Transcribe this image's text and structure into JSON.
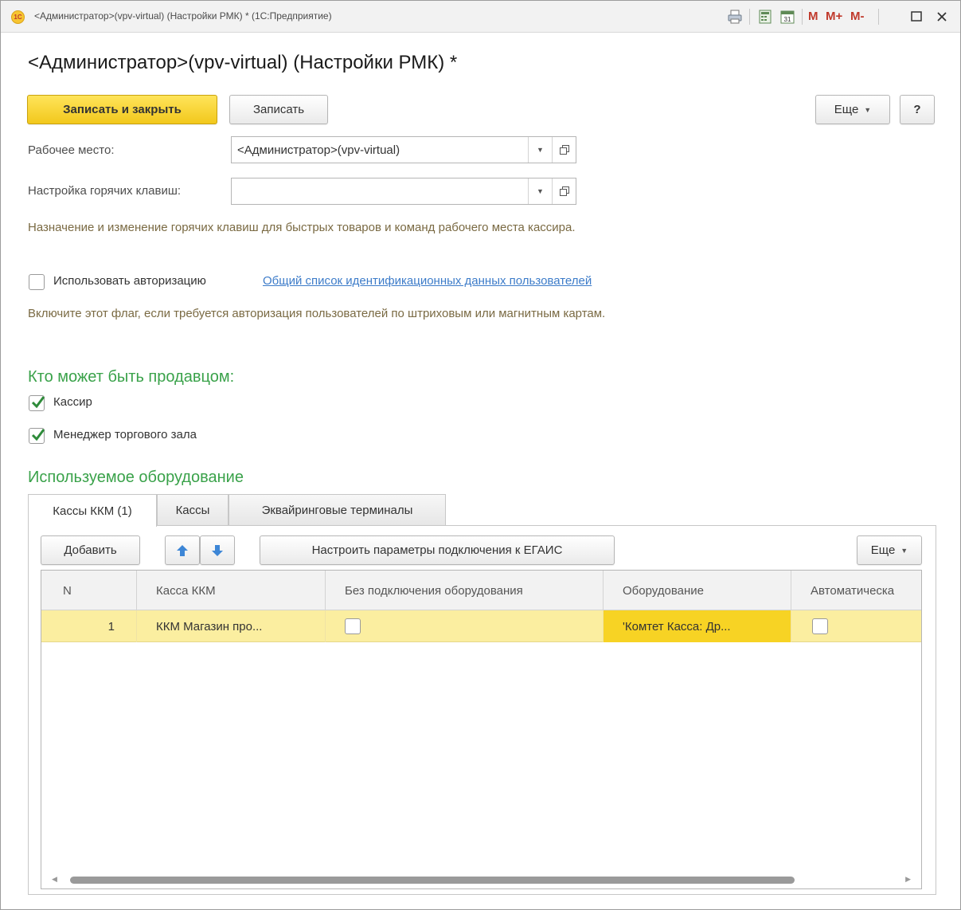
{
  "window": {
    "title": "<Администратор>(vpv-virtual) (Настройки РМК) * (1С:Предприятие)",
    "logo_text": "1С",
    "toolbar_m": "M",
    "toolbar_m_plus": "M+",
    "toolbar_m_minus": "M-"
  },
  "form": {
    "title": "<Администратор>(vpv-virtual) (Настройки РМК) *",
    "buttons": {
      "save_close": "Записать и закрыть",
      "save": "Записать",
      "more": "Еще",
      "help": "?"
    },
    "workplace_label": "Рабочее место:",
    "workplace_value": "<Администратор>(vpv-virtual)",
    "hotkeys_label": "Настройка горячих клавиш:",
    "hotkeys_value": "",
    "hotkeys_hint": "Назначение и изменение горячих клавиш для быстрых товаров и команд рабочего места кассира.",
    "use_auth_label": "Использовать авторизацию",
    "use_auth_checked": false,
    "auth_link": "Общий список идентификационных данных пользователей",
    "auth_hint": "Включите этот флаг, если требуется авторизация пользователей по штриховым или магнитным картам.",
    "sellers_title": "Кто может быть продавцом:",
    "sellers": [
      {
        "label": "Кассир",
        "checked": true
      },
      {
        "label": "Менеджер торгового зала",
        "checked": true
      }
    ],
    "equipment_title": "Используемое оборудование"
  },
  "tabs": [
    {
      "label": "Кассы ККМ (1)",
      "active": true
    },
    {
      "label": "Кассы",
      "active": false
    },
    {
      "label": "Эквайринговые терминалы",
      "active": false
    }
  ],
  "table_toolbar": {
    "add": "Добавить",
    "egais": "Настроить параметры подключения к ЕГАИС",
    "more": "Еще"
  },
  "table": {
    "columns": [
      "N",
      "Касса ККМ",
      "Без подключения оборудования",
      "Оборудование",
      "Автоматическа"
    ],
    "rows": [
      {
        "n": "1",
        "kkm": "ККМ Магазин про...",
        "no_equipment": false,
        "equipment": "'Комтет Касса: Др...",
        "auto": false
      }
    ]
  },
  "colors": {
    "primary_button": "#f2c81c",
    "section_title": "#3aa24a",
    "hint_text": "#7a6a43",
    "link": "#3d7cc9",
    "row_highlight": "#fbeea0",
    "cell_selected": "#f7d324"
  }
}
